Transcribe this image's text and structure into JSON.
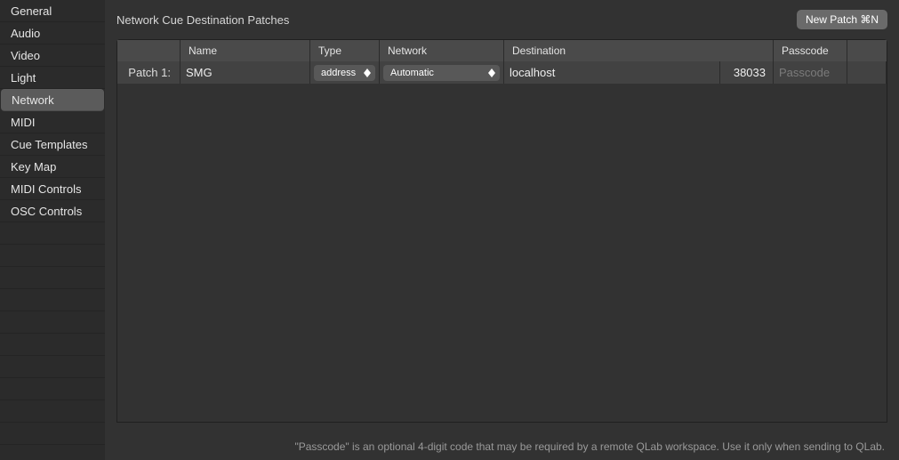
{
  "sidebar": {
    "items": [
      {
        "label": "General",
        "selected": false
      },
      {
        "label": "Audio",
        "selected": false
      },
      {
        "label": "Video",
        "selected": false
      },
      {
        "label": "Light",
        "selected": false
      },
      {
        "label": "Network",
        "selected": true
      },
      {
        "label": "MIDI",
        "selected": false
      },
      {
        "label": "Cue Templates",
        "selected": false
      },
      {
        "label": "Key Map",
        "selected": false
      },
      {
        "label": "MIDI Controls",
        "selected": false
      },
      {
        "label": "OSC Controls",
        "selected": false
      }
    ]
  },
  "header": {
    "title": "Network Cue Destination Patches",
    "new_patch_label": "New Patch  ⌘N"
  },
  "table": {
    "headers": {
      "name": "Name",
      "type": "Type",
      "network": "Network",
      "destination": "Destination",
      "passcode": "Passcode"
    },
    "rows": [
      {
        "label": "Patch 1:",
        "name": "SMG",
        "type": "address",
        "network": "Automatic",
        "destination": "localhost",
        "port": "38033",
        "passcode": "",
        "passcode_placeholder": "Passcode"
      }
    ]
  },
  "footer": {
    "note": "\"Passcode\" is an optional 4-digit code that may be required by a remote QLab workspace. Use it only when sending to QLab."
  }
}
